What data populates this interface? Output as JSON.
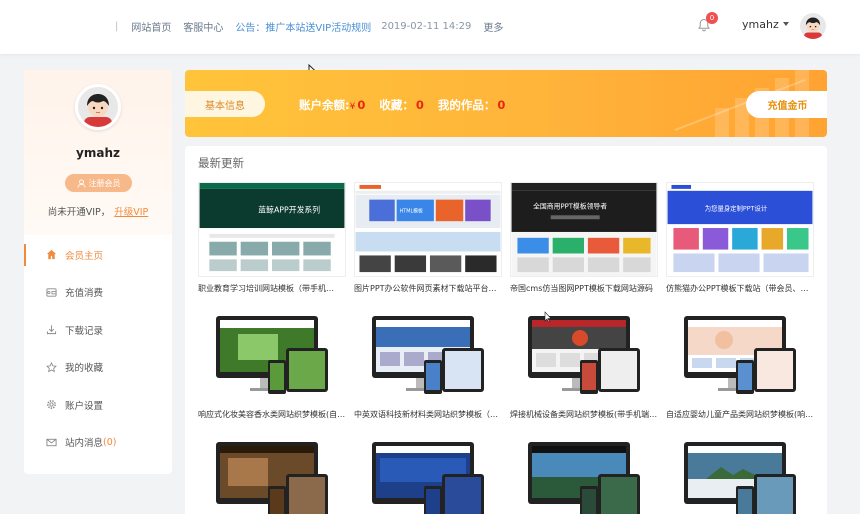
{
  "header": {
    "separator": "|",
    "nav": [
      "网站首页",
      "客服中心"
    ],
    "notice": "公告：推广本站送VIP活动规则",
    "date": "2019-02-11 14:29",
    "more": "更多",
    "notification_count": "0",
    "username": "ymahz"
  },
  "sidebar": {
    "username": "ymahz",
    "member_button": "注册会员",
    "vip_status": "尚未开通VIP，",
    "upgrade_link": "升级VIP",
    "menu": [
      {
        "label": "会员主页",
        "icon": "home-icon",
        "active": true
      },
      {
        "label": "充值消费",
        "icon": "wallet-icon"
      },
      {
        "label": "下载记录",
        "icon": "download-icon"
      },
      {
        "label": "我的收藏",
        "icon": "star-icon"
      },
      {
        "label": "账户设置",
        "icon": "gear-icon"
      },
      {
        "label": "站内消息",
        "icon": "mail-icon",
        "count": "(0)"
      }
    ]
  },
  "banner": {
    "tab": "基本信息",
    "balance_label": "账户余额:",
    "currency": "¥",
    "balance": "0",
    "favorites_label": "收藏：",
    "favorites": "0",
    "works_label": "我的作品：",
    "works": "0",
    "recharge": "充值金币"
  },
  "latest": {
    "title": "最新更新",
    "items": [
      {
        "title": "职业教育学习培训网站模板（带手机…",
        "thumb_text": "蓝鲸APP开发系列",
        "accent": "#0a6b4a"
      },
      {
        "title": "图片PPT办公软件网页素材下载站平台…",
        "thumb_text": "HTML模板",
        "accent": "#e8642a"
      },
      {
        "title": "帝国cms仿当图网PPT模板下载网站源码",
        "thumb_text": "全国商用PPT模板领导者",
        "accent": "#2a2a2a"
      },
      {
        "title": "仿熊猫办公PPT模板下载站（带会员、…",
        "thumb_text": "为您量身定制PPT设计",
        "accent": "#2c4fd8"
      },
      {
        "title": "响应式化妆美容香水类网站织梦模板(自…",
        "accent": "#3f7a2a"
      },
      {
        "title": "中英双语科技新材料类网站织梦模板（…",
        "accent": "#3a6fb8"
      },
      {
        "title": "焊接机械设备类网站织梦模板(带手机端…",
        "accent": "#b8262a"
      },
      {
        "title": "自适应婴幼儿童产品类网站织梦模板(响…",
        "accent": "#5a8fd0"
      },
      {
        "title": "",
        "accent": "#6b4a2a"
      },
      {
        "title": "",
        "accent": "#1e3f8a"
      },
      {
        "title": "",
        "accent": "#2a5a3a"
      },
      {
        "title": "",
        "accent": "#4a7a9a"
      }
    ]
  }
}
